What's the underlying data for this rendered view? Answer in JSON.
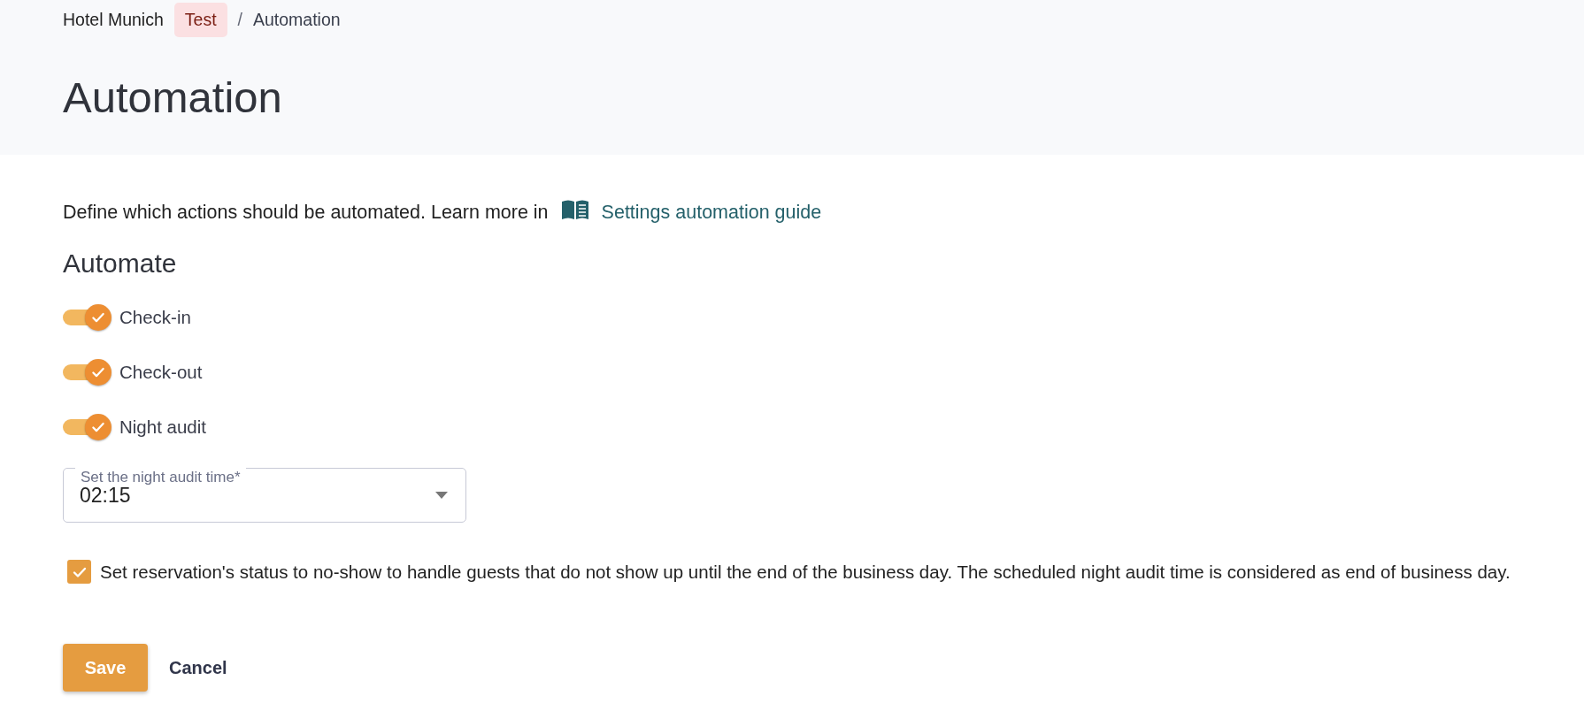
{
  "breadcrumb": {
    "items": [
      "Hotel Munich",
      "Automation"
    ],
    "badge": "Test",
    "separator": "/"
  },
  "title": "Automation",
  "intro": {
    "text": "Define which actions should be automated. Learn more in",
    "link": "Settings automation guide"
  },
  "section_title": "Automate",
  "toggles": [
    {
      "label": "Check-in",
      "on": true
    },
    {
      "label": "Check-out",
      "on": true
    },
    {
      "label": "Night audit",
      "on": true
    }
  ],
  "time_field": {
    "label": "Set the night audit time*",
    "value": "02:15"
  },
  "no_show": {
    "label": "Set reservation's status to no-show to handle guests that do not show up until the end of the business day. The scheduled night audit time is considered as end of business day.",
    "checked": true
  },
  "buttons": {
    "save": "Save",
    "cancel": "Cancel"
  }
}
